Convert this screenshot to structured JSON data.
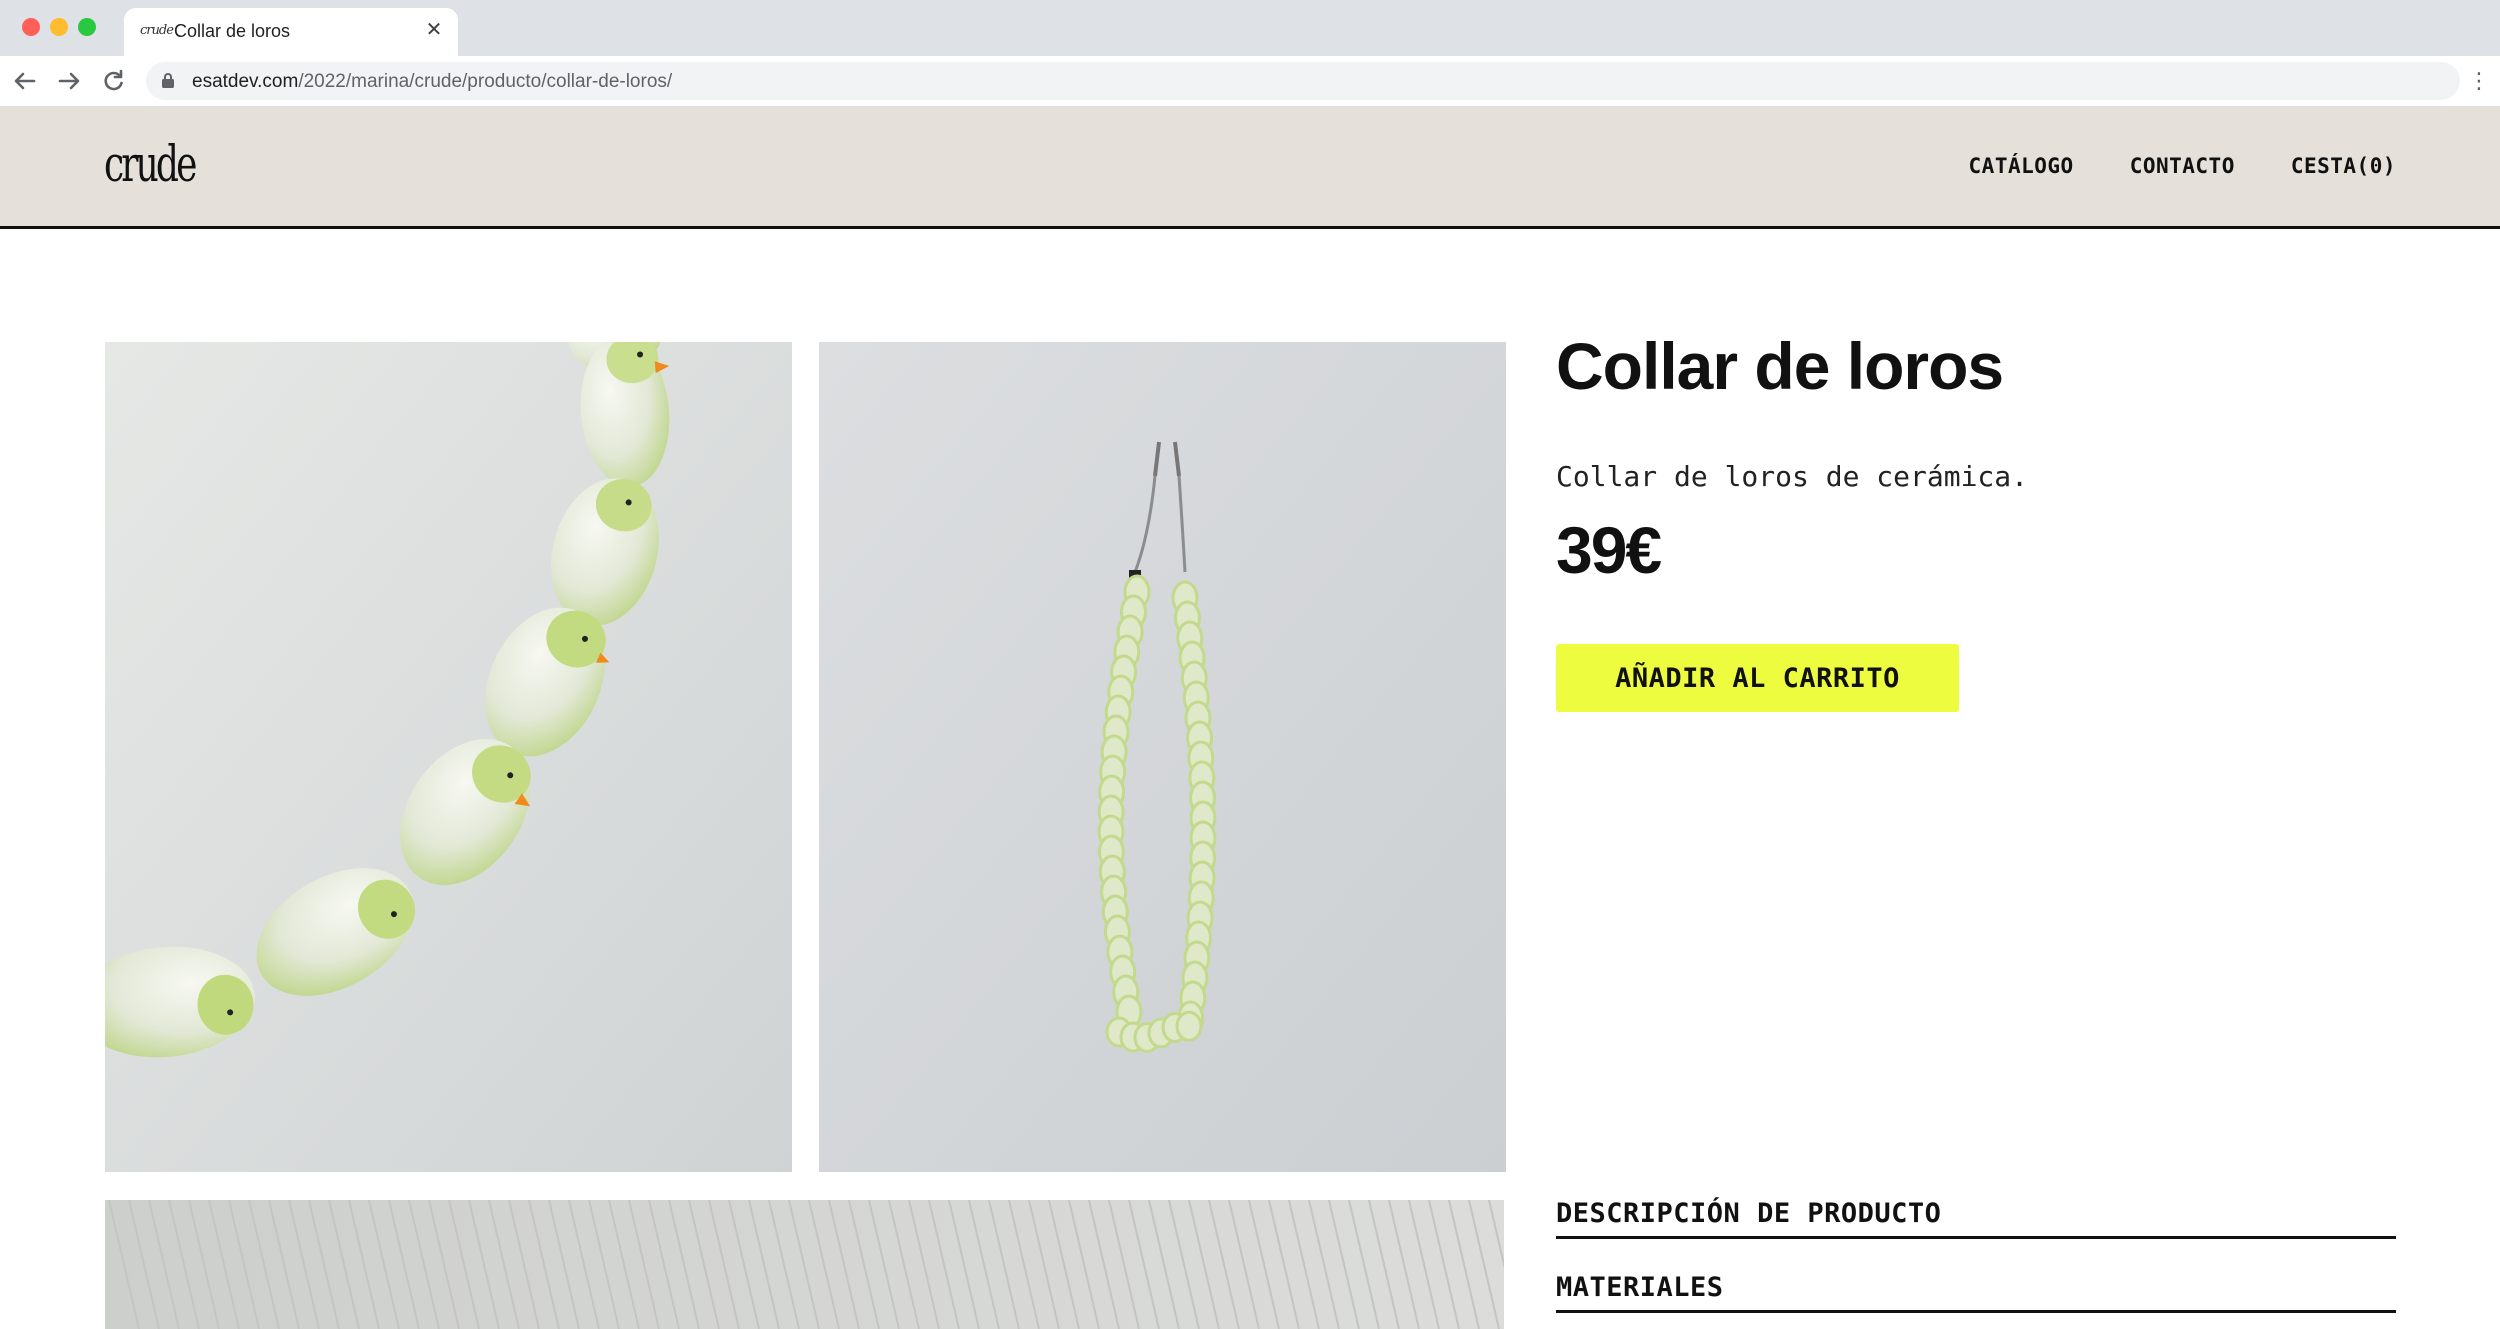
{
  "browser": {
    "tab_title": "Collar de loros",
    "tab_favicon_text": "crude",
    "url_host": "esatdev.com",
    "url_path": "/2022/marina/crude/producto/collar-de-loros/",
    "icons": [
      "back-arrow-icon",
      "forward-arrow-icon",
      "reload-icon",
      "lock-icon",
      "close-icon",
      "kebab-menu-icon"
    ]
  },
  "site": {
    "logo": "crude",
    "nav": {
      "catalog": "CATÁLOGO",
      "contact": "CONTACTO",
      "cart": "CESTA(0)"
    }
  },
  "product": {
    "title": "Collar de loros",
    "description": "Collar de loros de cerámica.",
    "price": "39€",
    "add_to_cart": "AÑADIR AL CARRITO",
    "sections": {
      "description_heading": "DESCRIPCIÓN DE PRODUCTO",
      "materials_heading": "MATERIALES"
    }
  },
  "colors": {
    "header_bg": "#e5e1da",
    "button_bg": "#eefc3f",
    "text": "#111111",
    "parrot_green": "#c5dc8a",
    "beak_orange": "#f08a1c"
  }
}
